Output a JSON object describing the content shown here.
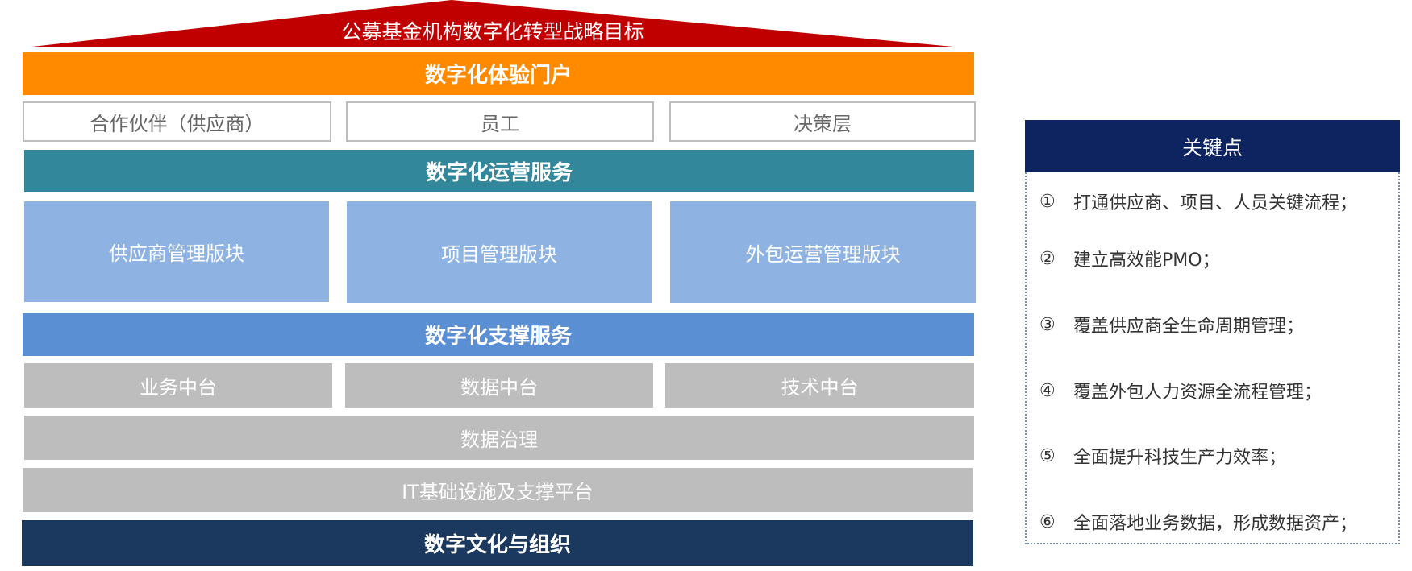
{
  "roof": {
    "title": "公募基金机构数字化转型战略目标",
    "color": "#c00000"
  },
  "portal": {
    "title": "数字化体验门户",
    "items": [
      "合作伙伴（供应商）",
      "员工",
      "决策层"
    ]
  },
  "operations": {
    "title": "数字化运营服务",
    "modules": [
      "供应商管理版块",
      "项目管理版块",
      "外包运营管理版块"
    ]
  },
  "support": {
    "title": "数字化支撑服务",
    "platforms": [
      "业务中台",
      "数据中台",
      "技术中台"
    ],
    "governance": "数据治理",
    "infrastructure": "IT基础设施及支撑平台"
  },
  "culture": {
    "title": "数字文化与组织"
  },
  "key_points": {
    "header": "关键点",
    "items": [
      {
        "num": "①",
        "text": "打通供应商、项目、人员关键流程；"
      },
      {
        "num": "②",
        "text": "建立高效能PMO；"
      },
      {
        "num": "③",
        "text": "覆盖供应商全生命周期管理；"
      },
      {
        "num": "④",
        "text": "覆盖外包人力资源全流程管理；"
      },
      {
        "num": "⑤",
        "text": "全面提升科技生产力效率；"
      },
      {
        "num": "⑥",
        "text": "全面落地业务数据，形成数据资产；"
      }
    ]
  }
}
